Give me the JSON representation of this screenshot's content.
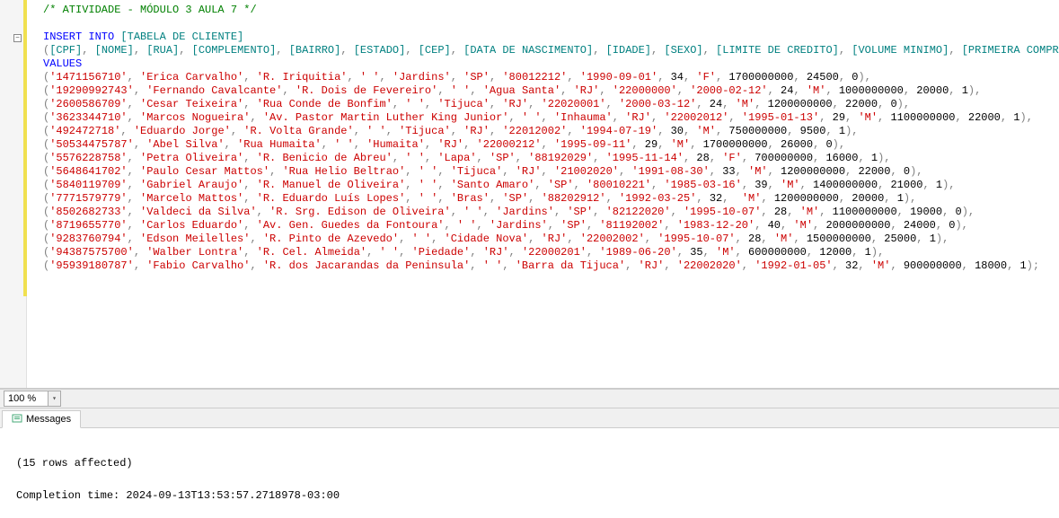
{
  "code": {
    "comment": "/* ATIVIDADE - MÓDULO 3 AULA 7 */",
    "insert_kw": "INSERT INTO",
    "table": "[TABELA DE CLIENTE]",
    "columns": [
      "[CPF]",
      "[NOME]",
      "[RUA]",
      "[COMPLEMENTO]",
      "[BAIRRO]",
      "[ESTADO]",
      "[CEP]",
      "[DATA DE NASCIMENTO]",
      "[IDADE]",
      "[SEXO]",
      "[LIMITE DE CREDITO]",
      "[VOLUME MINIMO]",
      "[PRIMEIRA COMPRA]"
    ],
    "values_kw": "VALUES",
    "rows": [
      {
        "cpf": "'1471156710'",
        "nome": "'Erica Carvalho'",
        "rua": "'R. Iriquitia'",
        "comp": "' '",
        "bairro": "'Jardins'",
        "est": "'SP'",
        "cep": "'80012212'",
        "nasc": "'1990-09-01'",
        "idade": "34",
        "sexo": "'F'",
        "limite": "1700000000",
        "vol": "24500",
        "prim": "0"
      },
      {
        "cpf": "'19290992743'",
        "nome": "'Fernando Cavalcante'",
        "rua": "'R. Dois de Fevereiro'",
        "comp": "' '",
        "bairro": "'Agua Santa'",
        "est": "'RJ'",
        "cep": "'22000000'",
        "nasc": "'2000-02-12'",
        "idade": "24",
        "sexo": "'M'",
        "limite": "1000000000",
        "vol": "20000",
        "prim": "1"
      },
      {
        "cpf": "'2600586709'",
        "nome": "'Cesar Teixeira'",
        "rua": "'Rua Conde de Bonfim'",
        "comp": "' '",
        "bairro": "'Tijuca'",
        "est": "'RJ'",
        "cep": "'22020001'",
        "nasc": "'2000-03-12'",
        "idade": "24",
        "sexo": "'M'",
        "limite": "1200000000",
        "vol": "22000",
        "prim": "0"
      },
      {
        "cpf": "'3623344710'",
        "nome": "'Marcos Nogueira'",
        "rua": "'Av. Pastor Martin Luther King Junior'",
        "comp": "' '",
        "bairro": "'Inhauma'",
        "est": "'RJ'",
        "cep": "'22002012'",
        "nasc": "'1995-01-13'",
        "idade": "29",
        "sexo": "'M'",
        "limite": "1100000000",
        "vol": "22000",
        "prim": "1"
      },
      {
        "cpf": "'492472718'",
        "nome": "'Eduardo Jorge'",
        "rua": "'R. Volta Grande'",
        "comp": "' '",
        "bairro": "'Tijuca'",
        "est": "'RJ'",
        "cep": "'22012002'",
        "nasc": "'1994-07-19'",
        "idade": "30",
        "sexo": "'M'",
        "limite": "750000000",
        "vol": "9500",
        "prim": "1"
      },
      {
        "cpf": "'50534475787'",
        "nome": "'Abel Silva'",
        "rua": "'Rua Humaita'",
        "comp": "' '",
        "bairro": "'Humaita'",
        "est": "'RJ'",
        "cep": "'22000212'",
        "nasc": "'1995-09-11'",
        "idade": "29",
        "sexo": "'M'",
        "limite": "1700000000",
        "vol": "26000",
        "prim": "0"
      },
      {
        "cpf": "'5576228758'",
        "nome": "'Petra Oliveira'",
        "rua": "'R. Benicio de Abreu'",
        "comp": "' '",
        "bairro": "'Lapa'",
        "est": "'SP'",
        "cep": "'88192029'",
        "nasc": "'1995-11-14'",
        "idade": "28",
        "sexo": "'F'",
        "limite": "700000000",
        "vol": "16000",
        "prim": "1"
      },
      {
        "cpf": "'5648641702'",
        "nome": "'Paulo Cesar Mattos'",
        "rua": "'Rua Helio Beltrao'",
        "comp": "' '",
        "bairro": "'Tijuca'",
        "est": "'RJ'",
        "cep": "'21002020'",
        "nasc": "'1991-08-30'",
        "idade": "33",
        "sexo": "'M'",
        "limite": "1200000000",
        "vol": "22000",
        "prim": "0"
      },
      {
        "cpf": "'5840119709'",
        "nome": "'Gabriel Araujo'",
        "rua": "'R. Manuel de Oliveira'",
        "comp": "' '",
        "bairro": "'Santo Amaro'",
        "est": "'SP'",
        "cep": "'80010221'",
        "nasc": "'1985-03-16'",
        "idade": "39",
        "sexo": "'M'",
        "limite": "1400000000",
        "vol": "21000",
        "prim": "1"
      },
      {
        "cpf": "'7771579779'",
        "nome": "'Marcelo Mattos'",
        "rua": "'R. Eduardo Luís Lopes'",
        "comp": "' '",
        "bairro": "'Bras'",
        "est": "'SP'",
        "cep": "'88202912'",
        "nasc": "'1992-03-25'",
        "idade": "32",
        "sexo": " 'M'",
        "limite": "1200000000",
        "vol": "20000",
        "prim": "1"
      },
      {
        "cpf": "'8502682733'",
        "nome": "'Valdeci da Silva'",
        "rua": "'R. Srg. Edison de Oliveira'",
        "comp": "' '",
        "bairro": "'Jardins'",
        "est": "'SP'",
        "cep": "'82122020'",
        "nasc": "'1995-10-07'",
        "idade": "28",
        "sexo": "'M'",
        "limite": "1100000000",
        "vol": "19000",
        "prim": "0"
      },
      {
        "cpf": "'8719655770'",
        "nome": "'Carlos Eduardo'",
        "rua": "'Av. Gen. Guedes da Fontoura'",
        "comp": "' '",
        "bairro": "'Jardins'",
        "est": "'SP'",
        "cep": "'81192002'",
        "nasc": "'1983-12-20'",
        "idade": "40",
        "sexo": "'M'",
        "limite": "2000000000",
        "vol": "24000",
        "prim": "0"
      },
      {
        "cpf": "'9283760794'",
        "nome": "'Edson Meilelles'",
        "rua": "'R. Pinto de Azevedo'",
        "comp": "' '",
        "bairro": "'Cidade Nova'",
        "est": "'RJ'",
        "cep": "'22002002'",
        "nasc": "'1995-10-07'",
        "idade": "28",
        "sexo": "'M'",
        "limite": "1500000000",
        "vol": "25000",
        "prim": "1"
      },
      {
        "cpf": "'94387575700'",
        "nome": "'Walber Lontra'",
        "rua": "'R. Cel. Almeida'",
        "comp": "' '",
        "bairro": "'Piedade'",
        "est": "'RJ'",
        "cep": "'22000201'",
        "nasc": "'1989-06-20'",
        "idade": "35",
        "sexo": "'M'",
        "limite": "600000000",
        "vol": "12000",
        "prim": "1"
      },
      {
        "cpf": "'95939180787'",
        "nome": "'Fabio Carvalho'",
        "rua": "'R. dos Jacarandas da Peninsula'",
        "comp": "' '",
        "bairro": "'Barra da Tijuca'",
        "est": "'RJ'",
        "cep": "'22002020'",
        "nasc": "'1992-01-05'",
        "idade": "32",
        "sexo": "'M'",
        "limite": "900000000",
        "vol": "18000",
        "prim": "1"
      }
    ]
  },
  "zoom": "100 %",
  "tab_label": "Messages",
  "messages": {
    "rows_affected": "(15 rows affected)",
    "completion": "Completion time: 2024-09-13T13:53:57.2718978-03:00"
  }
}
